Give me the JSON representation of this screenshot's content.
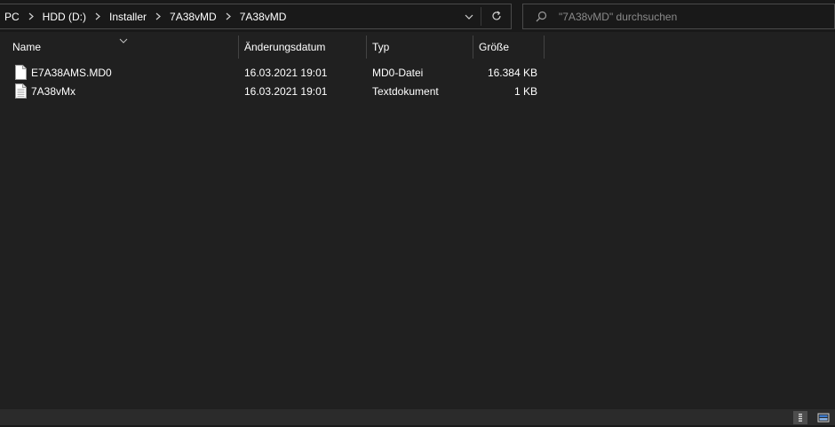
{
  "breadcrumb": {
    "items": [
      "PC",
      "HDD (D:)",
      "Installer",
      "7A38vMD",
      "7A38vMD"
    ]
  },
  "search": {
    "placeholder": "\"7A38vMD\" durchsuchen"
  },
  "columns": {
    "name": "Name",
    "date": "Änderungsdatum",
    "type": "Typ",
    "size": "Größe"
  },
  "files": [
    {
      "name": "E7A38AMS.MD0",
      "date": "16.03.2021 19:01",
      "type": "MD0-Datei",
      "size": "16.384 KB"
    },
    {
      "name": "7A38vMx",
      "date": "16.03.2021 19:01",
      "type": "Textdokument",
      "size": "1 KB"
    }
  ],
  "icons": {
    "breadcrumb_separator": "chevron-right-icon",
    "address_dropdown": "chevron-down-icon",
    "refresh": "refresh-icon",
    "search": "search-icon",
    "file": "file-icon",
    "sort": "sort-caret-icon",
    "details_view": "details-view-icon",
    "tiles_view": "large-icons-view-icon"
  },
  "colors": {
    "background": "#202020",
    "topbar": "#191919",
    "text": "#ffffff",
    "placeholder": "#8a8a8a",
    "border": "#4a4a4a",
    "statusbar": "#2b2b2b"
  }
}
